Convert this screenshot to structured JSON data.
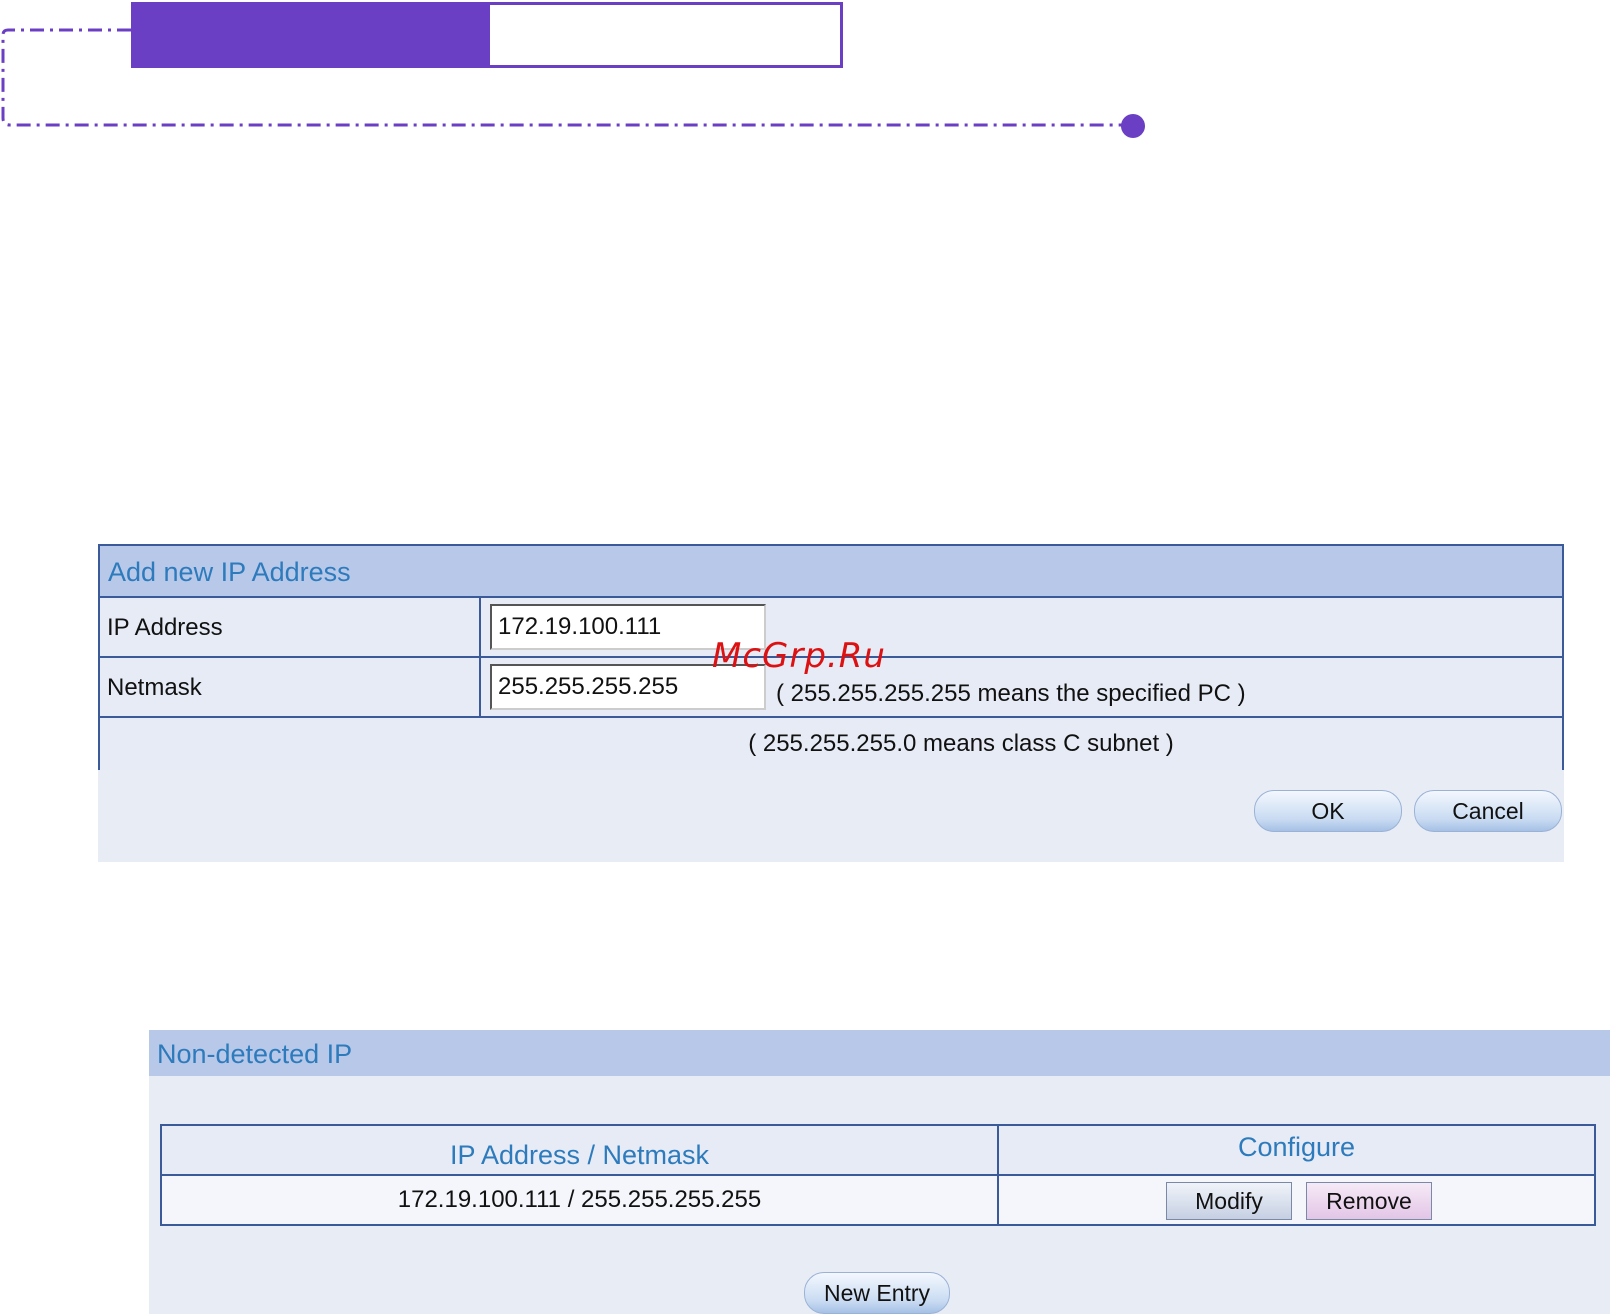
{
  "add_panel": {
    "title": "Add new IP Address",
    "ip_label": "IP Address",
    "ip_value": "172.19.100.111",
    "netmask_label": "Netmask",
    "netmask_value": "255.255.255.255",
    "netmask_hint": "( 255.255.255.255 means the specified PC )",
    "subnet_hint": "( 255.255.255.0 means class C subnet )",
    "ok_label": "OK",
    "cancel_label": "Cancel"
  },
  "list_panel": {
    "title": "Non-detected IP",
    "columns": [
      "IP Address / Netmask",
      "Configure"
    ],
    "rows": [
      {
        "ip_netmask": "172.19.100.111  / 255.255.255.255",
        "modify_label": "Modify",
        "remove_label": "Remove"
      }
    ],
    "new_entry_label": "New Entry"
  },
  "watermark": "McGrp.Ru",
  "colors": {
    "header_purple": "#6b3fc4",
    "panel_title_bg": "#b8c8e8",
    "panel_title_text": "#2d7bbd",
    "table_border": "#3b5a99",
    "watermark_red": "#d11111"
  }
}
